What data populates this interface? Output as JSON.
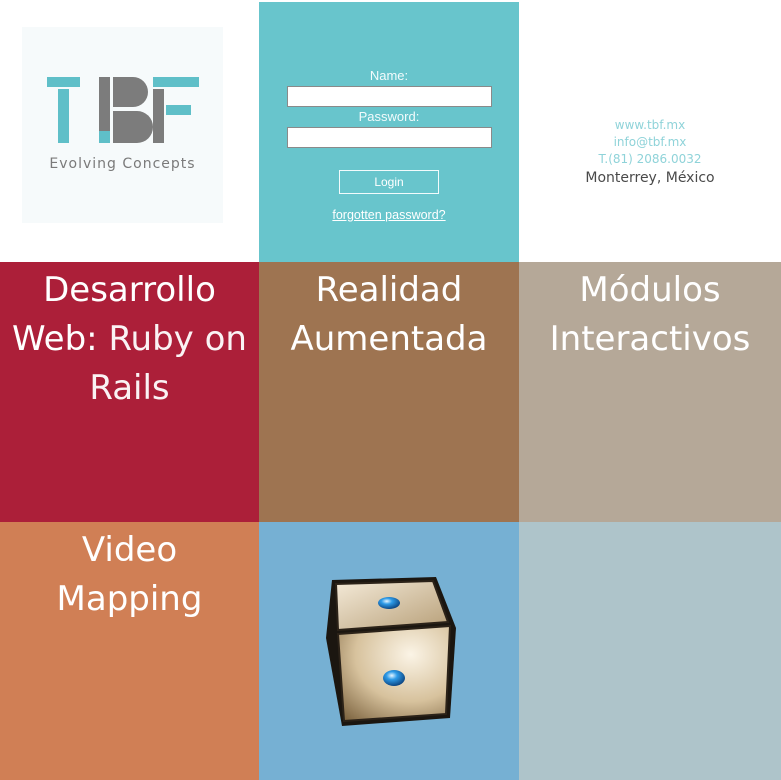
{
  "logo": {
    "mark": "TBF",
    "tagline": "Evolving Concepts",
    "colors": {
      "teal": "#5fbfc8",
      "gray": "#7c7c7c"
    }
  },
  "login": {
    "name_label": "Name:",
    "name_value": "",
    "password_label": "Password:",
    "password_value": "",
    "button_label": "Login",
    "forgot_link": "forgotten password?"
  },
  "contact": {
    "website": "www.tbf.mx",
    "email": "info@tbf.mx",
    "phone": "T.(81) 2086.0032",
    "city": "Monterrey, México"
  },
  "tiles": [
    {
      "line1": "Desarrollo",
      "line2_a": "Web:",
      "line2_b": "Ruby on",
      "line3": "Rails",
      "color": "#ac1f39"
    },
    {
      "line1": "Realidad",
      "line2": "Aumentada",
      "color": "#9e7451"
    },
    {
      "line1": "Módulos",
      "line2": "Interactivos",
      "color": "#b5a898"
    },
    {
      "line1": "Video",
      "line2": "Mapping",
      "color": "#d07f55"
    },
    {
      "icon": "dice-cube-icon",
      "color": "#76b0d3"
    },
    {
      "color": "#aec4ca"
    }
  ]
}
